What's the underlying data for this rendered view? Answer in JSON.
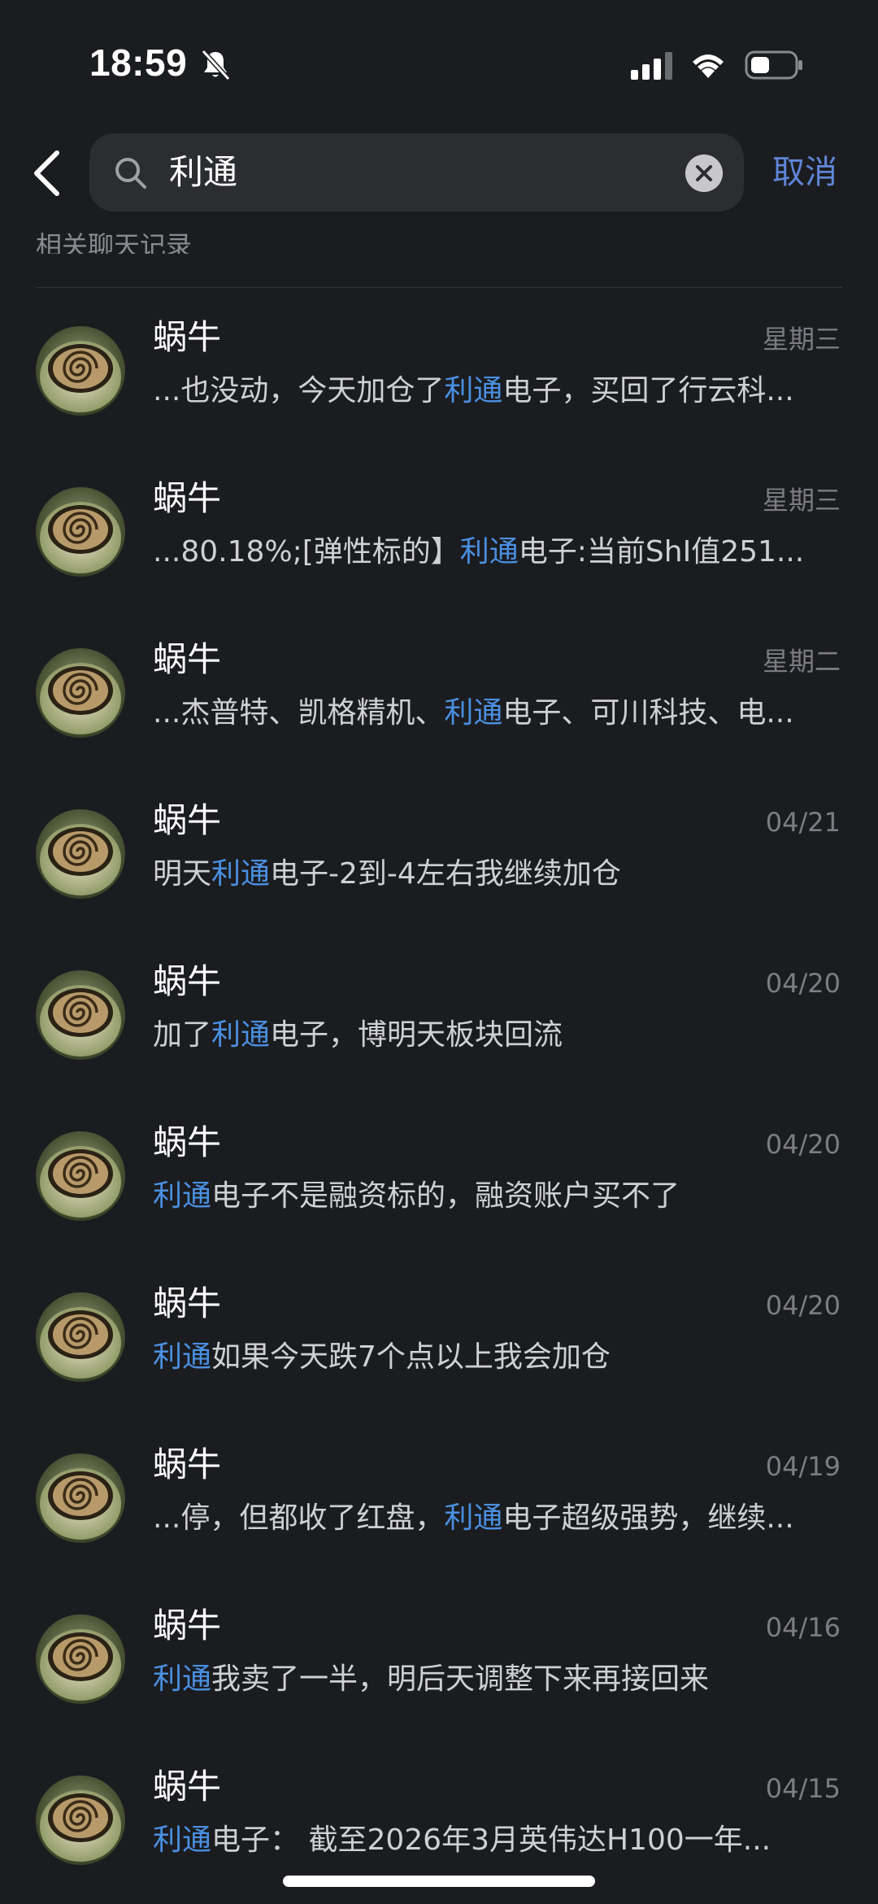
{
  "status_bar": {
    "time": "18:59"
  },
  "search": {
    "query": "利通",
    "cancel_label": "取消"
  },
  "section": {
    "label": "相关聊天记录"
  },
  "colors": {
    "background": "#1b1c20",
    "highlight": "#4a90e2",
    "cancel": "#5f86d8",
    "date": "#7c7d82"
  },
  "results": [
    {
      "name": "蜗牛",
      "date": "星期三",
      "pre": "...也没动，今天加仓了",
      "hl": "利通",
      "post": "电子，买回了行云科..."
    },
    {
      "name": "蜗牛",
      "date": "星期三",
      "pre": "...80.18%;[弹性标的】",
      "hl": "利通",
      "post": "电子:当前ShI值251..."
    },
    {
      "name": "蜗牛",
      "date": "星期二",
      "pre": "...杰普特、凯格精机、",
      "hl": "利通",
      "post": "电子、可川科技、电..."
    },
    {
      "name": "蜗牛",
      "date": "04/21",
      "pre": "明天",
      "hl": "利通",
      "post": "电子-2到-4左右我继续加仓"
    },
    {
      "name": "蜗牛",
      "date": "04/20",
      "pre": "加了",
      "hl": "利通",
      "post": "电子，博明天板块回流"
    },
    {
      "name": "蜗牛",
      "date": "04/20",
      "pre": "",
      "hl": "利通",
      "post": "电子不是融资标的，融资账户买不了"
    },
    {
      "name": "蜗牛",
      "date": "04/20",
      "pre": "",
      "hl": "利通",
      "post": "如果今天跌7个点以上我会加仓"
    },
    {
      "name": "蜗牛",
      "date": "04/19",
      "pre": "...停，但都收了红盘，",
      "hl": "利通",
      "post": "电子超级强势，继续..."
    },
    {
      "name": "蜗牛",
      "date": "04/16",
      "pre": "",
      "hl": "利通",
      "post": "我卖了一半，明后天调整下来再接回来"
    },
    {
      "name": "蜗牛",
      "date": "04/15",
      "pre": "",
      "hl": "利通",
      "post": "电子： 截至2026年3月英伟达H100一年..."
    }
  ]
}
